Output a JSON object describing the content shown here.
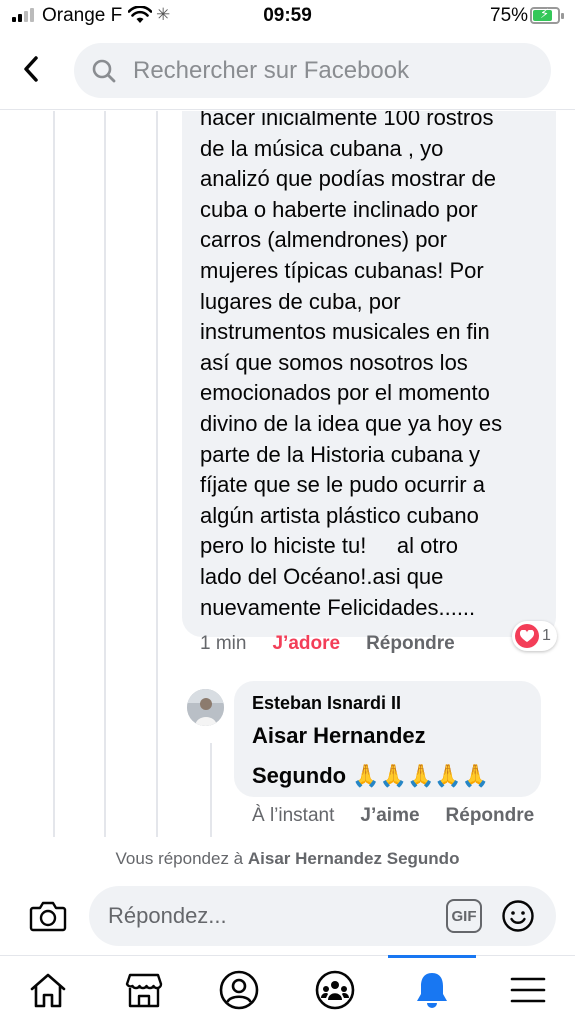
{
  "status_bar": {
    "carrier": "Orange F",
    "time": "09:59",
    "battery": "75%"
  },
  "header": {
    "search_placeholder": "Rechercher sur Facebook"
  },
  "comment": {
    "text": "hacer inicialmente 100 rostros\nde la música cubana , yo\nanalizó que podías mostrar de\ncuba o haberte inclinado por\ncarros (almendrones) por\nmujeres típicas cubanas! Por\nlugares de cuba, por\ninstrumentos musicales en fin\nasí que somos nosotros los\nemocionados por el momento\ndivino de la idea que ya hoy es\nparte de la Historia cubana y\nfíjate que se le pudo ocurrir a\nalgún artista plástico cubano\npero lo hiciste tu!     al otro\nlado del Océano!.asi que\nnuevamente Felicidades......",
    "time": "1 min",
    "react_label": "J’adore",
    "reply_label": "Répondre",
    "reaction_count": "1"
  },
  "reply": {
    "author": "Esteban Isnardi II",
    "text_line1": "Aisar Hernandez",
    "text_line2": "Segundo",
    "emojis": "🙏🙏🙏🙏🙏",
    "time": "À l’instant",
    "like_label": "J’aime",
    "reply_label": "Répondre"
  },
  "composer": {
    "replying_prefix": "Vous répondez à ",
    "replying_name": "Aisar Hernandez Segundo",
    "placeholder": "Répondez...",
    "gif_label": "GIF"
  },
  "tabs": [
    "home-icon",
    "marketplace-icon",
    "profile-icon",
    "groups-icon",
    "notifications-icon",
    "menu-icon"
  ],
  "colors": {
    "accent": "#1877f2",
    "love": "#f33e58",
    "bubble": "#f0f2f5",
    "secondary_text": "#65676b"
  }
}
